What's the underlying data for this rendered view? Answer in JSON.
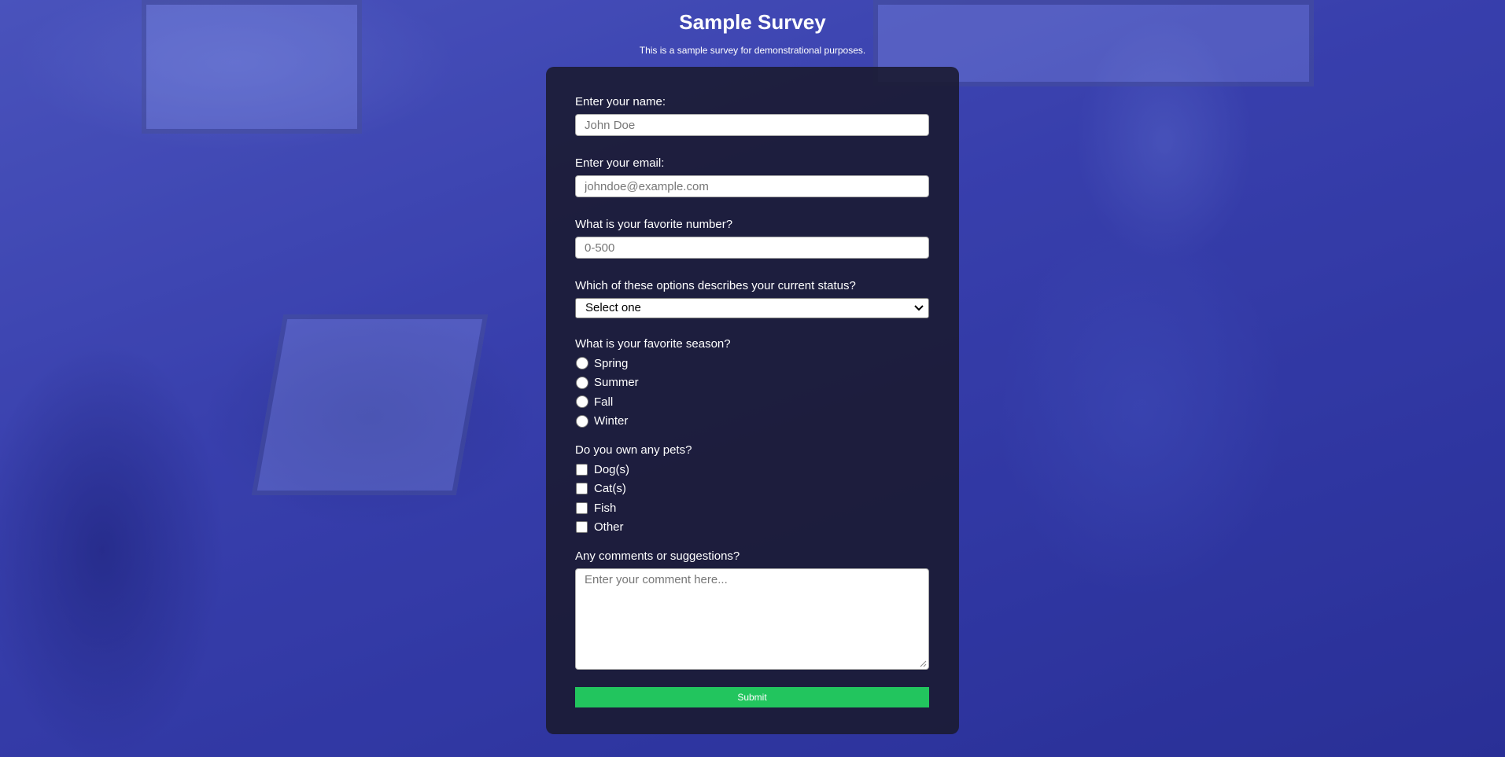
{
  "page": {
    "title": "Sample Survey",
    "description": "This is a sample survey for demonstrational purposes."
  },
  "form": {
    "name": {
      "label": "Enter your name:",
      "placeholder": "John Doe",
      "value": ""
    },
    "email": {
      "label": "Enter your email:",
      "placeholder": "johndoe@example.com",
      "value": ""
    },
    "number": {
      "label": "What is your favorite number?",
      "placeholder": "0-500",
      "value": ""
    },
    "status": {
      "label": "Which of these options describes your current status?",
      "selected": "Select one"
    },
    "season": {
      "label": "What is your favorite season?",
      "options": [
        "Spring",
        "Summer",
        "Fall",
        "Winter"
      ]
    },
    "pets": {
      "label": "Do you own any pets?",
      "options": [
        "Dog(s)",
        "Cat(s)",
        "Fish",
        "Other"
      ]
    },
    "comments": {
      "label": "Any comments or suggestions?",
      "placeholder": "Enter your comment here..."
    },
    "submit_label": "Submit"
  },
  "colors": {
    "submit_bg": "#22c55e",
    "card_bg": "#1b1b32",
    "page_bg": "#3e46b4"
  }
}
